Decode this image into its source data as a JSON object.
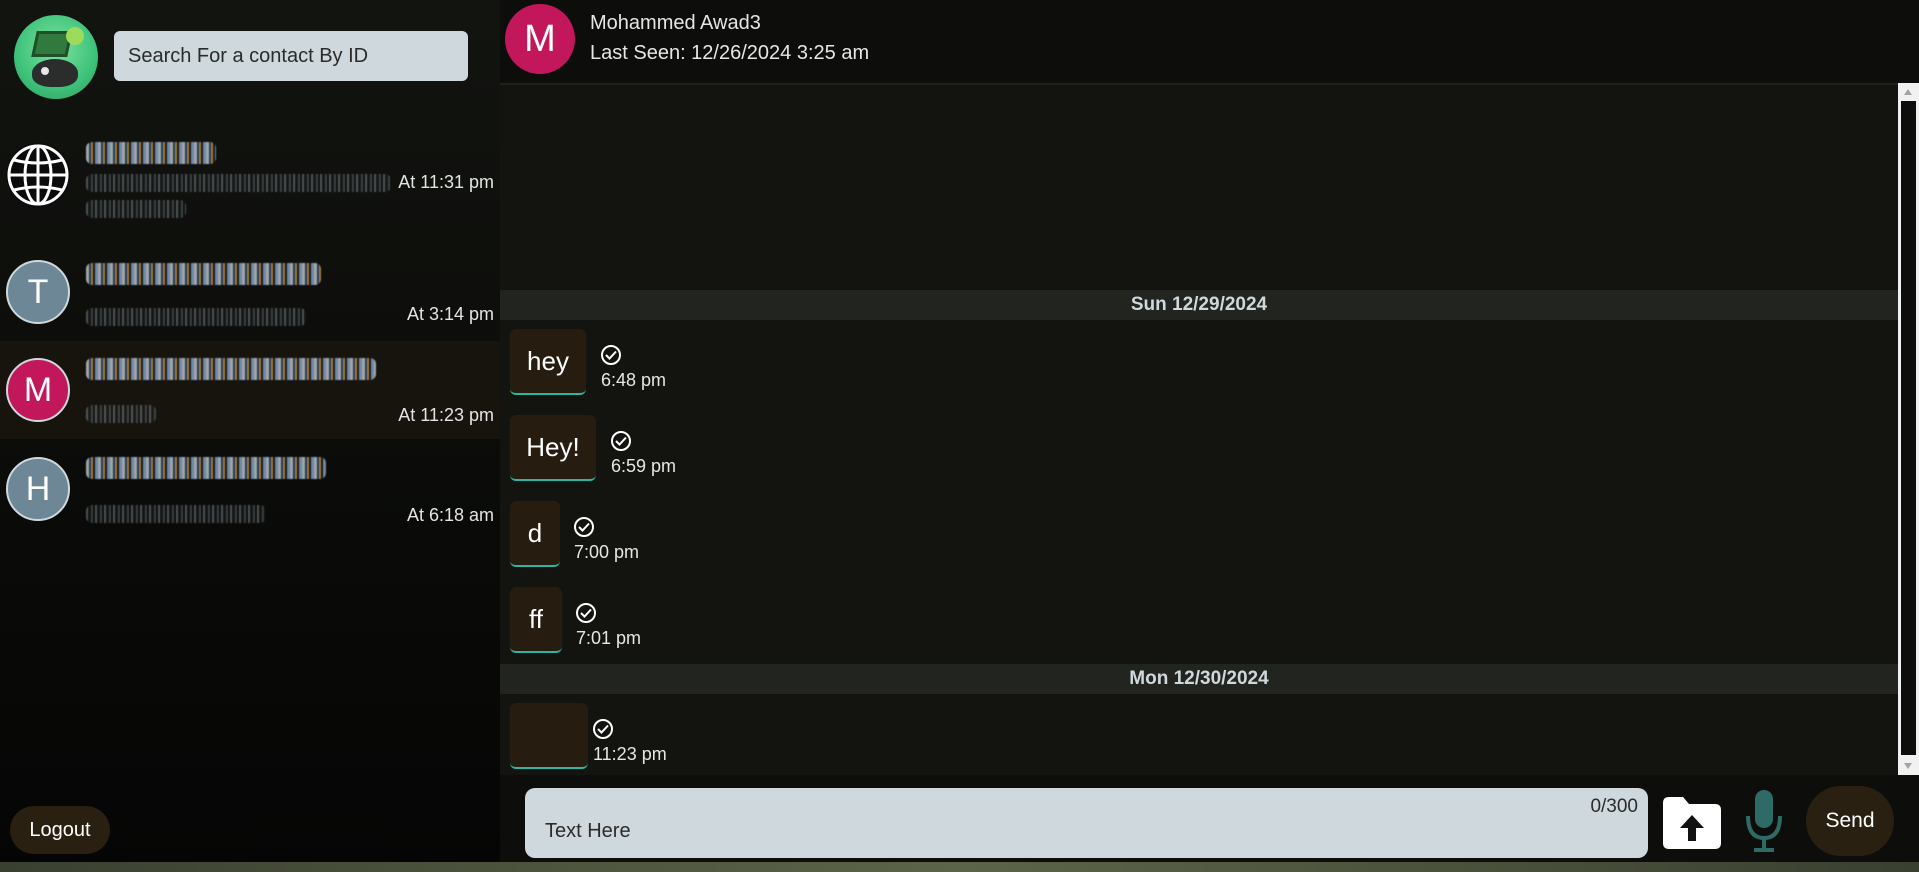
{
  "sidebar": {
    "search": {
      "placeholder": "Search For a contact By ID",
      "value": ""
    },
    "contacts": [
      {
        "avatar_letter": "",
        "avatar_icon": "globe-icon",
        "time": "At 11:31 pm"
      },
      {
        "avatar_letter": "T",
        "avatar_color": "#6d8797",
        "time": "At 3:14 pm"
      },
      {
        "avatar_letter": "M",
        "avatar_color": "#c2185b",
        "time": "At 11:23 pm",
        "active": true
      },
      {
        "avatar_letter": "H",
        "avatar_color": "#6d8797",
        "time": "At 6:18 am"
      }
    ],
    "logout_label": "Logout"
  },
  "chat": {
    "header": {
      "avatar_letter": "M",
      "name": "Mohammed Awad3",
      "last_seen": "Last Seen: 12/26/2024 3:25 am"
    },
    "days": [
      {
        "label": "Sun 12/29/2024",
        "messages": [
          {
            "text": "hey",
            "time": "6:48 pm"
          },
          {
            "text": "Hey!",
            "time": "6:59 pm"
          },
          {
            "text": "d",
            "time": "7:00 pm"
          },
          {
            "text": "ff",
            "time": "7:01 pm"
          }
        ]
      },
      {
        "label": "Mon 12/30/2024",
        "messages": [
          {
            "text": "",
            "time": "11:23 pm"
          }
        ]
      }
    ],
    "composer": {
      "placeholder": "Text Here",
      "value": "",
      "char_count": "0/300"
    },
    "send_label": "Send"
  },
  "colors": {
    "accent_pink": "#c2185b",
    "avatar_gray": "#6d8797",
    "bubble_bg": "#271c10",
    "bubble_underline": "#2bb5a5",
    "input_bg": "#cfd8dc",
    "mic_teal": "#2e6b66"
  }
}
